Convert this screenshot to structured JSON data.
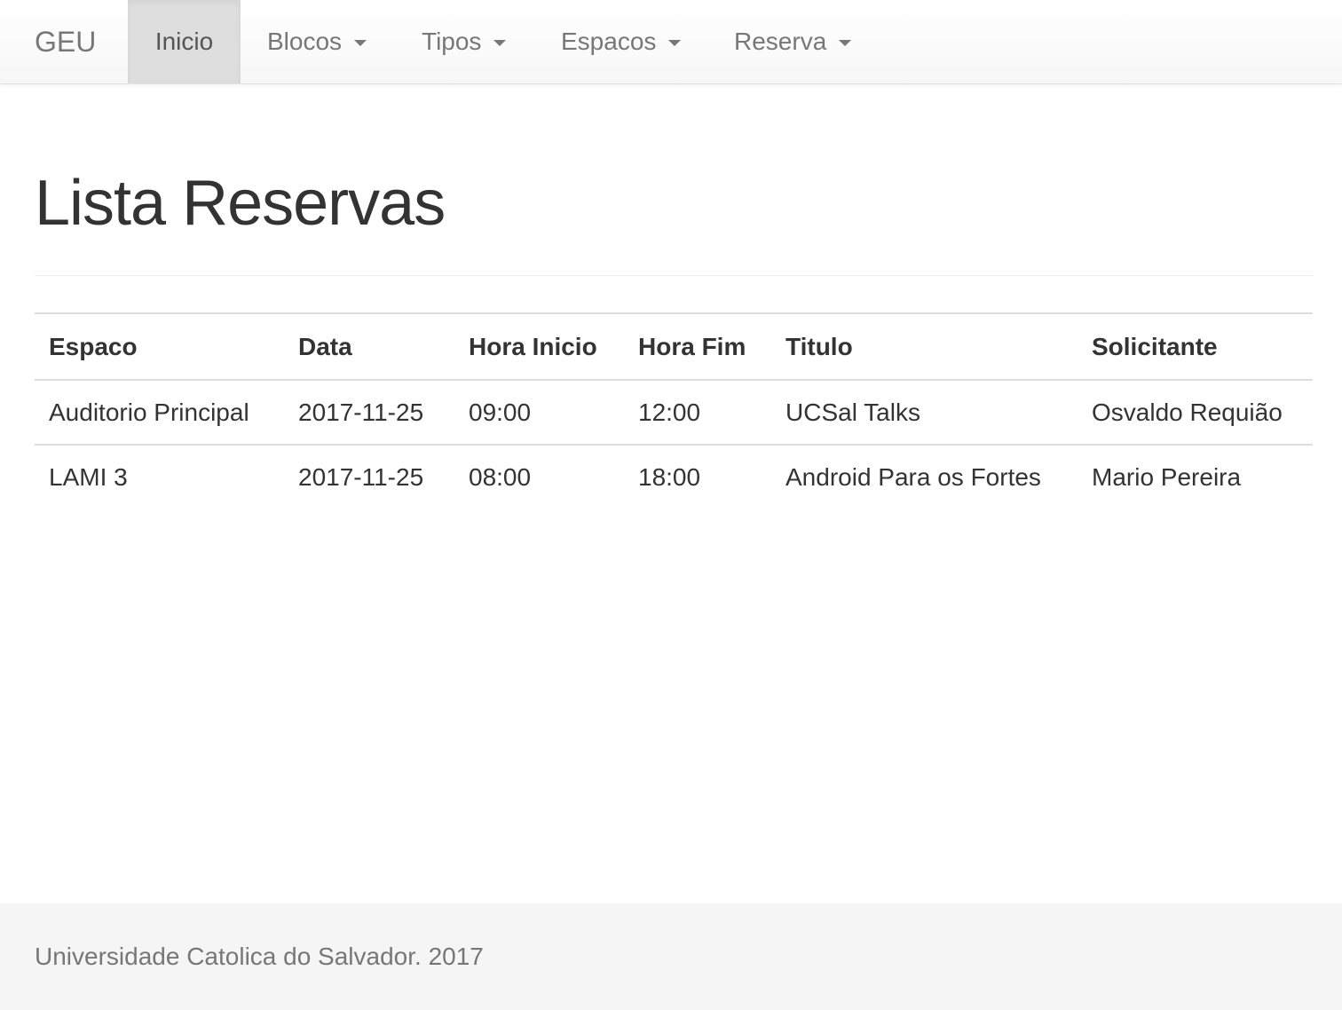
{
  "navbar": {
    "brand": "GEU",
    "items": [
      {
        "label": "Inicio",
        "active": true,
        "dropdown": false
      },
      {
        "label": "Blocos",
        "active": false,
        "dropdown": true
      },
      {
        "label": "Tipos",
        "active": false,
        "dropdown": true
      },
      {
        "label": "Espacos",
        "active": false,
        "dropdown": true
      },
      {
        "label": "Reserva",
        "active": false,
        "dropdown": true
      }
    ]
  },
  "page": {
    "title": "Lista Reservas"
  },
  "table": {
    "headers": [
      "Espaco",
      "Data",
      "Hora Inicio",
      "Hora Fim",
      "Titulo",
      "Solicitante"
    ],
    "rows": [
      [
        "Auditorio Principal",
        "2017-11-25",
        "09:00",
        "12:00",
        "UCSal Talks",
        "Osvaldo Requião"
      ],
      [
        "LAMI 3",
        "2017-11-25",
        "08:00",
        "18:00",
        "Android Para os Fortes",
        "Mario Pereira"
      ]
    ]
  },
  "footer": {
    "text": "Universidade Catolica do Salvador. 2017"
  }
}
